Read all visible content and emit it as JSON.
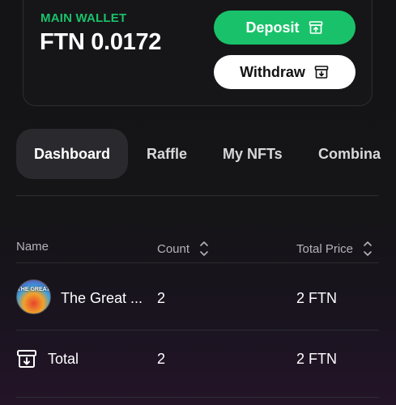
{
  "wallet": {
    "label": "MAIN WALLET",
    "balance": "FTN 0.0172",
    "deposit_label": "Deposit",
    "withdraw_label": "Withdraw"
  },
  "tabs": [
    {
      "label": "Dashboard",
      "active": true
    },
    {
      "label": "Raffle",
      "active": false
    },
    {
      "label": "My NFTs",
      "active": false
    },
    {
      "label": "Combina",
      "active": false
    }
  ],
  "table": {
    "columns": [
      "Name",
      "Count",
      "Total Price"
    ],
    "rows": [
      {
        "name": "The Great ...",
        "count": "2",
        "total_price": "2 FTN",
        "avatar_text": "THE GREAT"
      }
    ],
    "total": {
      "name": "Total",
      "count": "2",
      "total_price": "2 FTN"
    }
  },
  "colors": {
    "accent": "#19c26a",
    "background": "#141416",
    "active_tab": "#2a2a2e"
  },
  "icons": {
    "deposit": "archive-upload-icon",
    "withdraw": "archive-download-icon",
    "sort": "sort-arrows-icon",
    "total": "archive-download-icon"
  }
}
